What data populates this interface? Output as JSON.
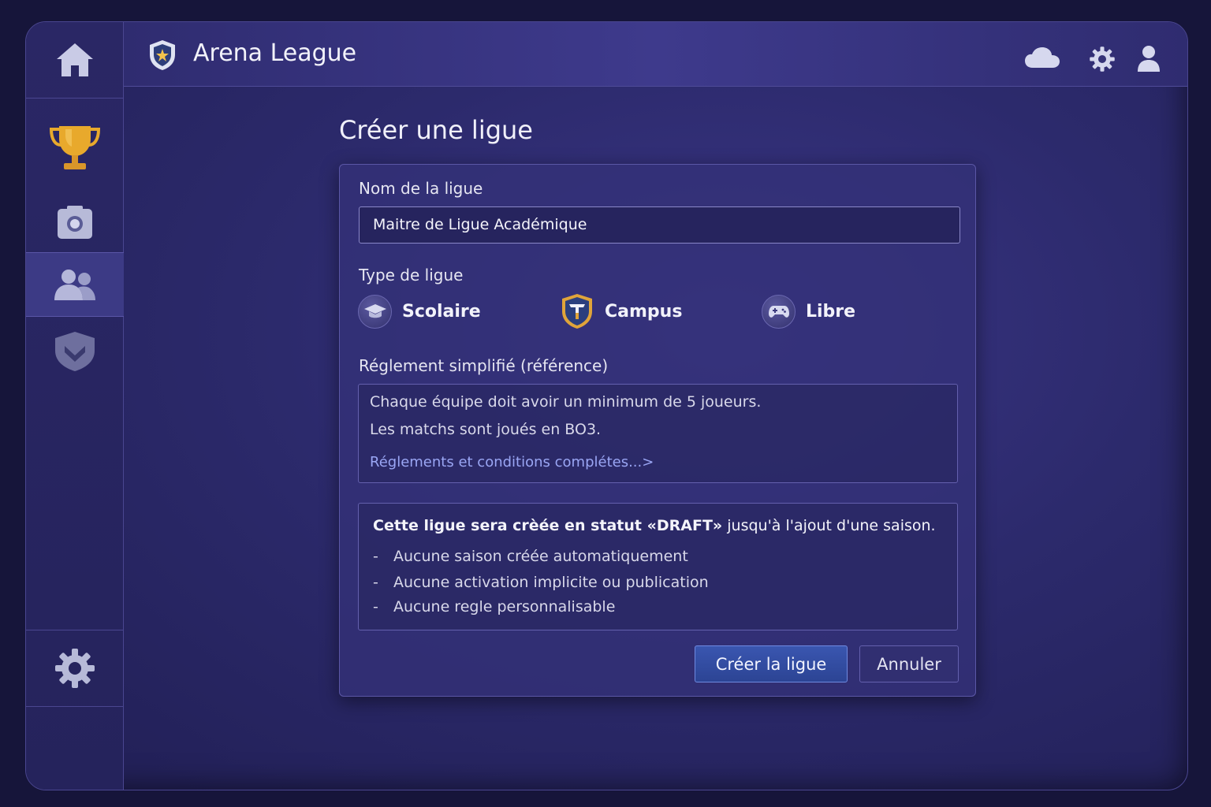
{
  "app": {
    "title": "Arena League"
  },
  "page": {
    "title": "Créer une ligue"
  },
  "form": {
    "name_label": "Nom de la ligue",
    "name_value": "Maitre de Ligue Académique",
    "type_label": "Type de ligue",
    "types": [
      {
        "label": "Scolaire",
        "icon": "graduation-cap-icon"
      },
      {
        "label": "Campus",
        "icon": "campus-shield-icon"
      },
      {
        "label": "Libre",
        "icon": "gamepad-icon"
      }
    ],
    "rules_label": "Réglement simplifié (référence)",
    "rules_lines": [
      "Chaque équipe doit avoir un minimum de 5 joueurs.",
      "Les matchs sont joués en BO3."
    ],
    "rules_link": "Réglements et conditions complétes...>",
    "notice": {
      "headline_bold": "Cette ligue sera crèée en statut «DRAFT»",
      "headline_rest": " jusqu'à l'ajout d'une saison.",
      "bullets": [
        "Aucune saison créée automatiquement",
        "Aucune activation implicite ou publication",
        "Aucune regle personnalisable"
      ],
      "dash": "-"
    },
    "submit_label": "Créer la ligue",
    "cancel_label": "Annuler"
  },
  "sidebar": {
    "items": [
      {
        "icon": "home-icon"
      },
      {
        "icon": "trophy-icon"
      },
      {
        "icon": "camera-icon"
      },
      {
        "icon": "users-icon",
        "active": true
      },
      {
        "icon": "shield-emblem-icon"
      },
      {
        "icon": "gear-icon"
      }
    ]
  },
  "topbar": {
    "icons": [
      "cloud-icon",
      "gear-icon",
      "user-icon"
    ]
  },
  "colors": {
    "accent": "#3a56b0",
    "link": "#9aa6f4",
    "background": "#2c2a6c",
    "trophy": "#e6a52a"
  }
}
